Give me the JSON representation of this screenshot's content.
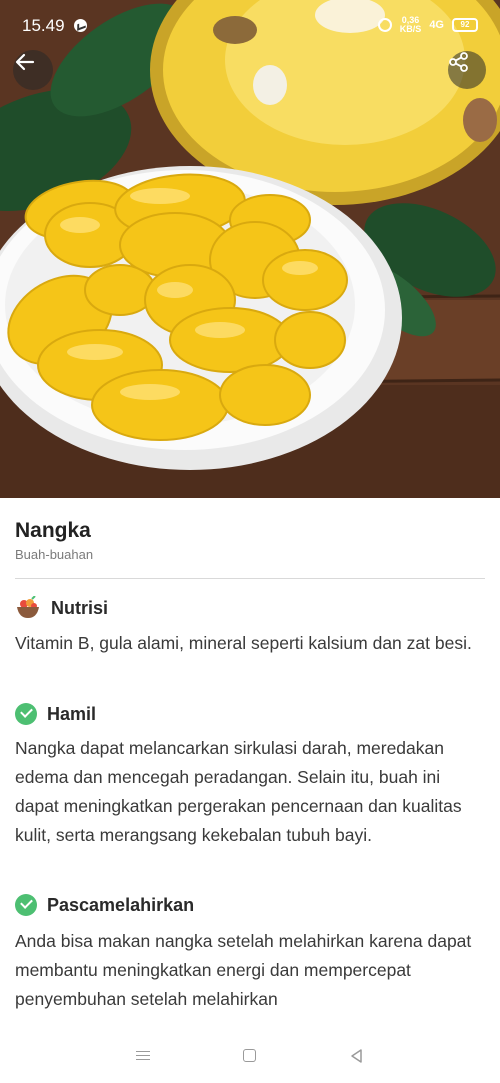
{
  "status_bar": {
    "time": "15.49",
    "net_speed_top": "0,36",
    "net_speed_bottom": "KB/S",
    "signal": "4G",
    "battery": "92"
  },
  "hero": {
    "alt": "Nangka",
    "icons": {
      "back": "arrow-left-icon",
      "share": "share-icon"
    }
  },
  "food": {
    "name": "Nangka",
    "category": "Buah-buahan"
  },
  "sections": [
    {
      "icon": "nutrition-bowl-icon",
      "title": "Nutrisi",
      "body": "Vitamin B, gula alami, mineral seperti kalsium dan zat besi."
    },
    {
      "icon": "check-circle-icon",
      "title": "Hamil",
      "body": "Nangka dapat melancarkan sirkulasi darah, meredakan edema dan mencegah peradangan. Selain itu, buah ini dapat meningkatkan pergerakan pencernaan dan kualitas kulit, serta merangsang kekebalan tubuh bayi."
    },
    {
      "icon": "check-circle-icon",
      "title": "Pascamelahirkan",
      "body": "Anda bisa makan nangka setelah melahirkan karena dapat membantu meningkatkan energi dan mempercepat penyembuhan setelah melahirkan"
    }
  ],
  "colors": {
    "accent_green": "#4dbf72",
    "fruit_yellow": "#f5c518",
    "wood_brown": "#5e3824"
  },
  "nav": {
    "menu": "menu-icon",
    "home": "home-icon",
    "back": "back-triangle-icon"
  }
}
